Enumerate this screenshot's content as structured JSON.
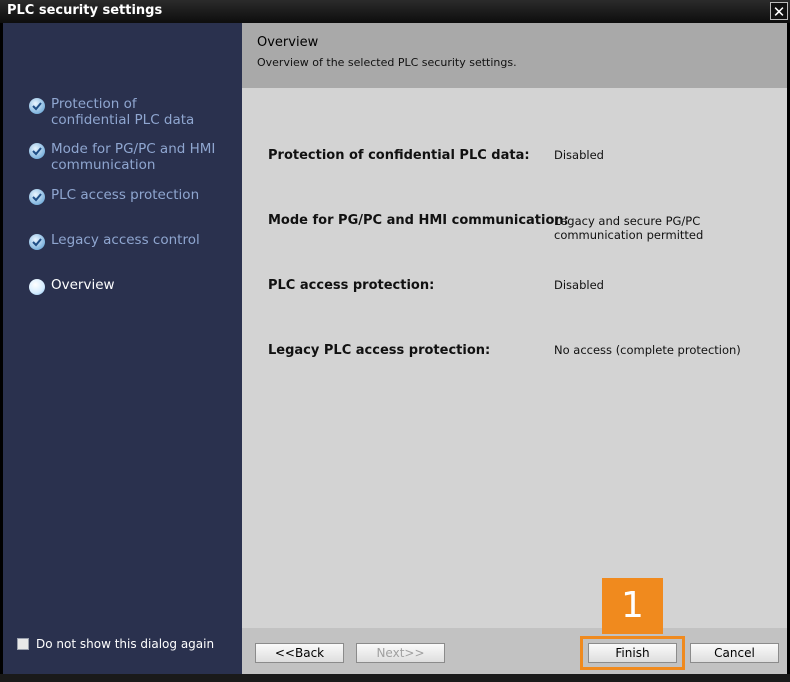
{
  "window": {
    "title": "PLC security settings",
    "close_glyph": "✕"
  },
  "sidebar": {
    "steps": [
      {
        "label": "Protection of\nconfidential PLC data",
        "state": "done"
      },
      {
        "label": "Mode for PG/PC and HMI\ncommunication",
        "state": "done"
      },
      {
        "label": "PLC access protection",
        "state": "done"
      },
      {
        "label": "Legacy access control",
        "state": "done"
      },
      {
        "label": "Overview",
        "state": "current"
      }
    ],
    "checkbox_label": "Do not show this dialog again",
    "checkbox_checked": false
  },
  "header": {
    "title": "Overview",
    "subtitle": "Overview of the selected PLC security settings."
  },
  "overview": {
    "rows": [
      {
        "label": "Protection of confidential PLC data:",
        "value": "Disabled"
      },
      {
        "label": "Mode for PG/PC and HMI communication:",
        "value": "Legacy and secure PG/PC communication permitted"
      },
      {
        "label": "PLC access protection:",
        "value": "Disabled"
      },
      {
        "label": "Legacy PLC access protection:",
        "value": "No access (complete protection)"
      }
    ]
  },
  "buttons": {
    "back": "<<Back",
    "next": "Next>>",
    "finish": "Finish",
    "cancel": "Cancel"
  },
  "annotation": {
    "marker": "1"
  },
  "colors": {
    "sidebar": "#2a314e",
    "accent": "#f08a1e",
    "header": "#a9a9a9",
    "content": "#d3d3d3"
  }
}
